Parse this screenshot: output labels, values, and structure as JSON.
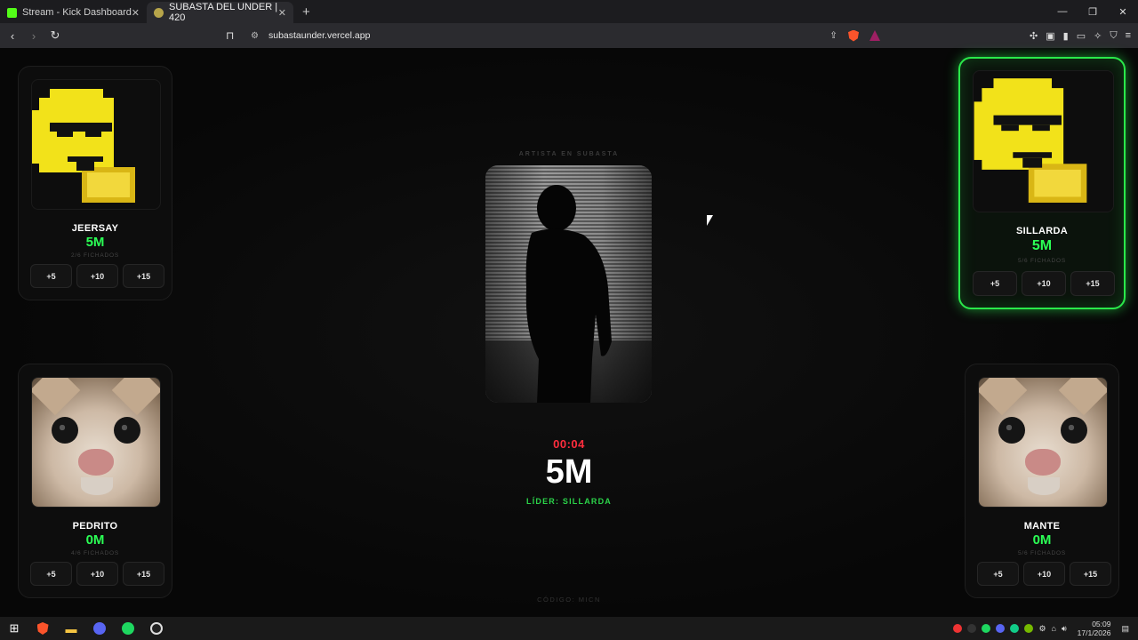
{
  "browser": {
    "tabs": [
      {
        "title": "Stream - Kick Dashboard",
        "active": false
      },
      {
        "title": "SUBASTA DEL UNDER | 420",
        "active": true
      }
    ],
    "url": "subastaunder.vercel.app"
  },
  "page": {
    "artist_label": "ARTISTA EN SUBASTA",
    "timer": "00:04",
    "current_bid": "5M",
    "leader": "LÍDER: SILLARDA",
    "code": "CÓDIGO: MICN"
  },
  "bidders": [
    {
      "name": "JEERSAY",
      "amount": "5M",
      "signed": "2/6 FICHADOS",
      "avatar": "pixel-emoji",
      "buttons": [
        "+5",
        "+10",
        "+15"
      ]
    },
    {
      "name": "SILLARDA",
      "amount": "5M",
      "signed": "5/6 FICHADOS",
      "avatar": "pixel-emoji",
      "is_leader": true,
      "buttons": [
        "+5",
        "+10",
        "+15"
      ]
    },
    {
      "name": "PEDRITO",
      "amount": "0M",
      "signed": "4/6 FICHADOS",
      "avatar": "cat",
      "buttons": [
        "+5",
        "+10",
        "+15"
      ]
    },
    {
      "name": "MANTE",
      "amount": "0M",
      "signed": "5/6 FICHADOS",
      "avatar": "cat",
      "buttons": [
        "+5",
        "+10",
        "+15"
      ]
    }
  ],
  "taskbar": {
    "time": "05:09",
    "date": "17/1/2026"
  },
  "colors": {
    "accent_green": "#2bff55",
    "timer_red": "#ff2d3d",
    "background": "#0a0a0a"
  }
}
